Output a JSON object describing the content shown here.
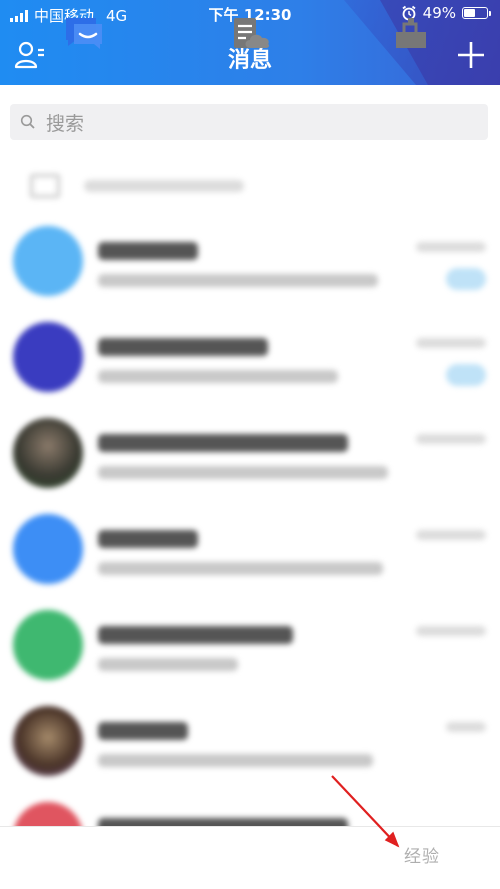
{
  "status_bar": {
    "carrier": "中国移动",
    "network": "4G",
    "time": "下午 12:30",
    "battery_percent": "49%",
    "battery_level": 0.49
  },
  "header": {
    "title": "消息",
    "left_icon": "contacts-icon",
    "right_icon": "plus-icon"
  },
  "search": {
    "icon": "search-icon",
    "placeholder": "搜索"
  },
  "colors": {
    "header_blue": "#1f8cf2",
    "header_violet": "#3a62d4",
    "tab_active": "#2d6ee8",
    "tab_inactive": "#777777",
    "annotation_arrow": "#e02020"
  },
  "tabs": [
    {
      "icon": "messages-icon",
      "active": true
    },
    {
      "icon": "contacts-doc-icon",
      "active": false
    },
    {
      "icon": "discover-icon",
      "active": false
    }
  ],
  "watermark": "经验"
}
